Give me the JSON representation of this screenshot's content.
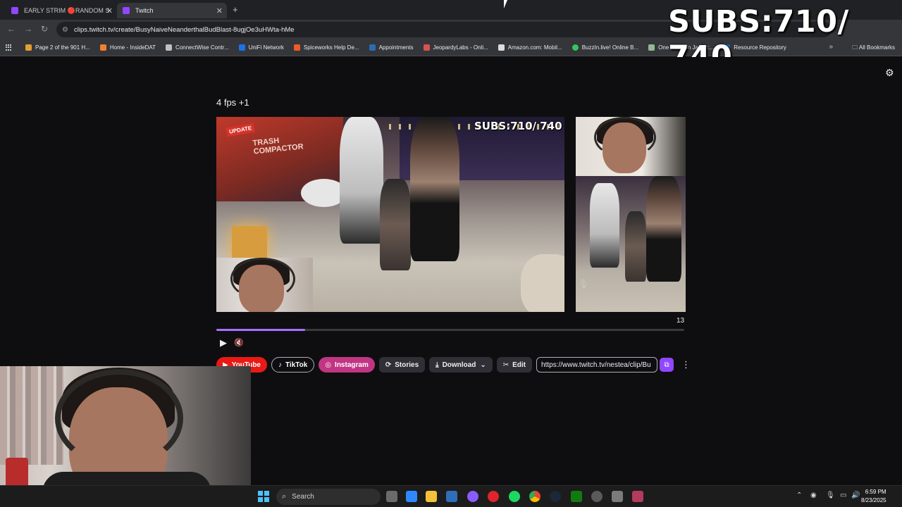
{
  "browser": {
    "tabs": [
      {
        "label": "EARLY STRIM 🔴RANDOM S"
      },
      {
        "label": "Twitch"
      }
    ],
    "url": "clips.twitch.tv/create/BusyNaiveNeanderthalBudBlast-8ugjOe3uHWta-hMe",
    "bookmarks": [
      {
        "label": "Page 2 of the 901 H...",
        "color": "#e0a030"
      },
      {
        "label": "Home - InsideDAT",
        "color": "#f08030"
      },
      {
        "label": "ConnectWise Contr...",
        "color": "#c0c0c0"
      },
      {
        "label": "UniFi Network",
        "color": "#1a73e8"
      },
      {
        "label": "Spiceworks Help De...",
        "color": "#f05a28"
      },
      {
        "label": "Appointments",
        "color": "#2b6cb0"
      },
      {
        "label": "JeopardyLabs - Onli...",
        "color": "#d9534f"
      },
      {
        "label": "Amazon.com: Mobil...",
        "color": "#dcdcdc"
      },
      {
        "label": "BuzzIn.live! Online B...",
        "color": "#34c759"
      },
      {
        "label": "One Week in Japan:...",
        "color": "#8fbc8f"
      },
      {
        "label": "Resource Repository",
        "color": "#1565c0"
      }
    ],
    "all_bookmarks": "All Bookmarks"
  },
  "overlay": {
    "subs": "SUBS:710/ 740"
  },
  "clip": {
    "title": "4 fps +1",
    "frame_subs": "SUBS:710/ 740",
    "frame_count": "13",
    "progress": 0.19
  },
  "actions": {
    "youtube": "YouTube",
    "tiktok": "TikTok",
    "instagram": "Instagram",
    "stories": "Stories",
    "download": "Download",
    "edit": "Edit",
    "share_url": "https://www.twitch.tv/nestea/clip/Bu"
  },
  "taskbar": {
    "search_placeholder": "Search",
    "time": "6:59 PM",
    "date": "8/23/2025",
    "icons": [
      {
        "name": "file-explorer-icon",
        "color": "#f3c13a"
      },
      {
        "name": "photos-icon",
        "color": "#2f88ff"
      },
      {
        "name": "messenger-icon",
        "color": "#8a5cff"
      },
      {
        "name": "opera-icon",
        "color": "#e0242c"
      },
      {
        "name": "spotify-icon",
        "color": "#1ed760"
      },
      {
        "name": "chrome-icon",
        "color": "#4285f4"
      },
      {
        "name": "steam-icon",
        "color": "#1b2838"
      },
      {
        "name": "xbox-icon",
        "color": "#107c10"
      }
    ]
  }
}
